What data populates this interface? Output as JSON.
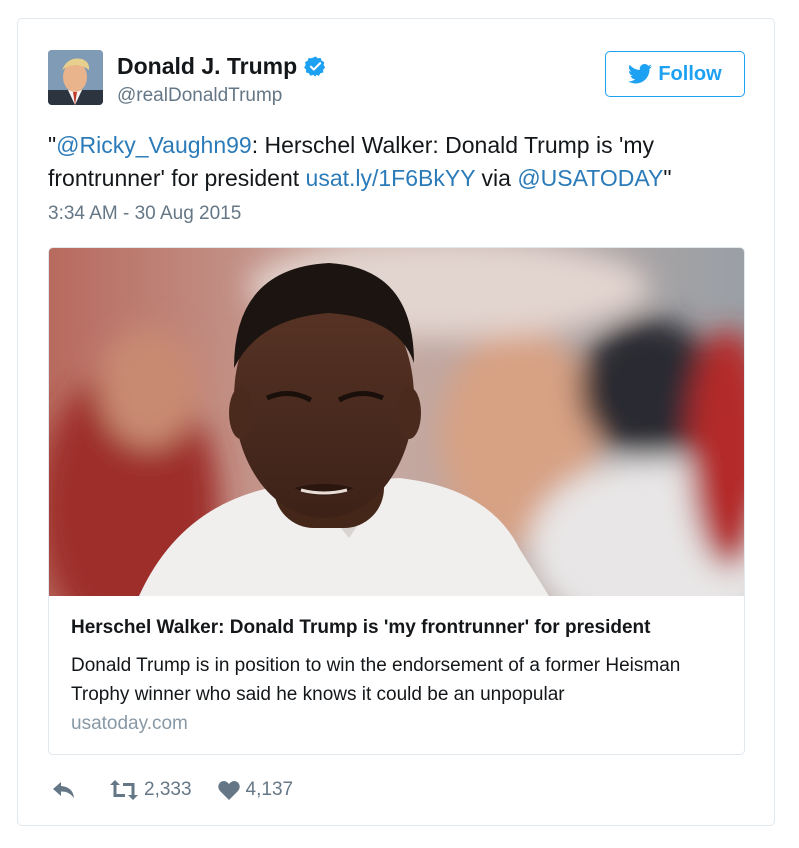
{
  "author": {
    "name": "Donald J. Trump",
    "handle": "@realDonaldTrump",
    "verified_icon": "verified-badge-icon"
  },
  "follow_button": {
    "label": "Follow",
    "icon": "twitter-bird-icon"
  },
  "tweet": {
    "quote_open": "\"",
    "mention_1": "@Ricky_Vaughn99",
    "text_1": ": Herschel Walker: Donald Trump is 'my frontrunner' for president ",
    "link": "usat.ly/1F6BkYY",
    "text_2": " via ",
    "mention_2": "@USATODAY",
    "quote_close": "\"",
    "timestamp": "3:34 AM - 30 Aug 2015"
  },
  "card": {
    "title": "Herschel Walker: Donald Trump is 'my frontrunner' for president",
    "description": "Donald Trump is in position to win the endorsement of a former Heisman Trophy winner who said he knows it could be an unpopular",
    "domain": "usatoday.com"
  },
  "actions": {
    "reply_icon": "reply-icon",
    "retweet_icon": "retweet-icon",
    "retweet_count": "2,333",
    "like_icon": "heart-icon",
    "like_count": "4,137"
  },
  "colors": {
    "link": "#2b7bb9",
    "accent": "#1da1f2",
    "muted": "#657786"
  }
}
